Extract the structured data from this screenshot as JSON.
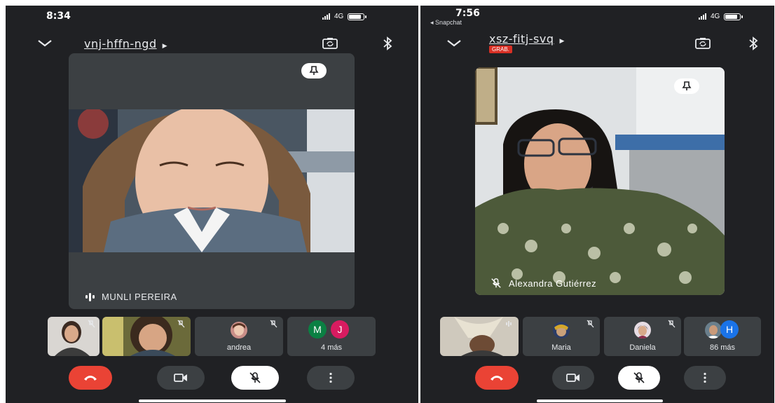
{
  "left": {
    "status": {
      "time": "8:34",
      "network": "4G"
    },
    "meeting_code": "vnj-hffn-ngd",
    "speaker": {
      "name": "MUNLI PEREIRA"
    },
    "participants": [
      {
        "name": "andrea"
      },
      {
        "label": "4 más",
        "initials": [
          "M",
          "J"
        ],
        "colors": [
          "#0b8043",
          "#d81b60"
        ]
      }
    ]
  },
  "right": {
    "status": {
      "time": "7:56",
      "network": "4G",
      "back_app": "◂ Snapchat"
    },
    "meeting_code": "xsz-fitj-svq",
    "recording_badge": "GRAB.",
    "speaker": {
      "name": "Alexandra Gutiérrez"
    },
    "participants": [
      {
        "name": "Maria"
      },
      {
        "name": "Daniela"
      },
      {
        "label": "86 más",
        "initials": [
          "H"
        ],
        "colors": [
          "#1a73e8"
        ]
      }
    ]
  },
  "colors": {
    "end_call": "#ea4335",
    "background": "#202124",
    "tile": "#3c4043",
    "recording": "#d93025"
  },
  "icons": [
    "chevron-down-icon",
    "play-arrow-icon",
    "camera-switch-icon",
    "bluetooth-icon",
    "pin-icon",
    "mic-off-icon",
    "end-call-icon",
    "video-camera-icon",
    "more-vert-icon",
    "audio-level-icon"
  ]
}
